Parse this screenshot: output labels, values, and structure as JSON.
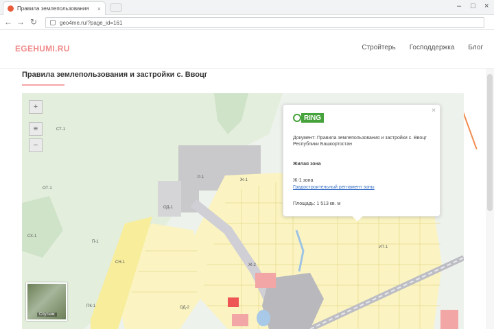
{
  "browser": {
    "tab_title": "Правила землепользования",
    "tab_close": "×",
    "url": "geo4me.ru/?page_id=161",
    "window_controls": [
      "–",
      "□",
      "×"
    ],
    "nav_icons": [
      "back-arrow",
      "forward-arrow",
      "reload"
    ]
  },
  "site": {
    "logo": "EGEHUMI.RU",
    "nav": [
      "Стройтерь",
      "Господдержка",
      "Блог"
    ]
  },
  "page": {
    "title": "Правила землепользования и застройки с. Ввоцг"
  },
  "map": {
    "controls": {
      "zoom_in": "+",
      "layers": "≡",
      "zoom_out": "−"
    },
    "minimap_label": "Спутник",
    "zone_labels": [
      "СТ-1",
      "ОТ-1",
      "СХ-1",
      "Р-1",
      "Ж-1",
      "ОД-1",
      "П-1",
      "СН-1",
      "Ж-2",
      "ИТ-1",
      "ПК-1",
      "ОД-2"
    ],
    "colors": {
      "residential": "#fbf4c2",
      "industrial": "#c9c9cb",
      "forest": "#d5e8cf",
      "water": "#a9c9e8",
      "road": "#bfbfc7",
      "accent": "#f28a4a"
    }
  },
  "popup": {
    "logo_text": "RING",
    "close": "×",
    "doc_label": "Документ: Правила землепользования и застройки с. Ввоцг Республики Башкортостан",
    "zone_label": "Ж-1 зона",
    "zone_title": "Жилая зона",
    "link_label": "Градостроительный регламент зоны",
    "area_label": "Площадь: 1 513 кв. м"
  }
}
